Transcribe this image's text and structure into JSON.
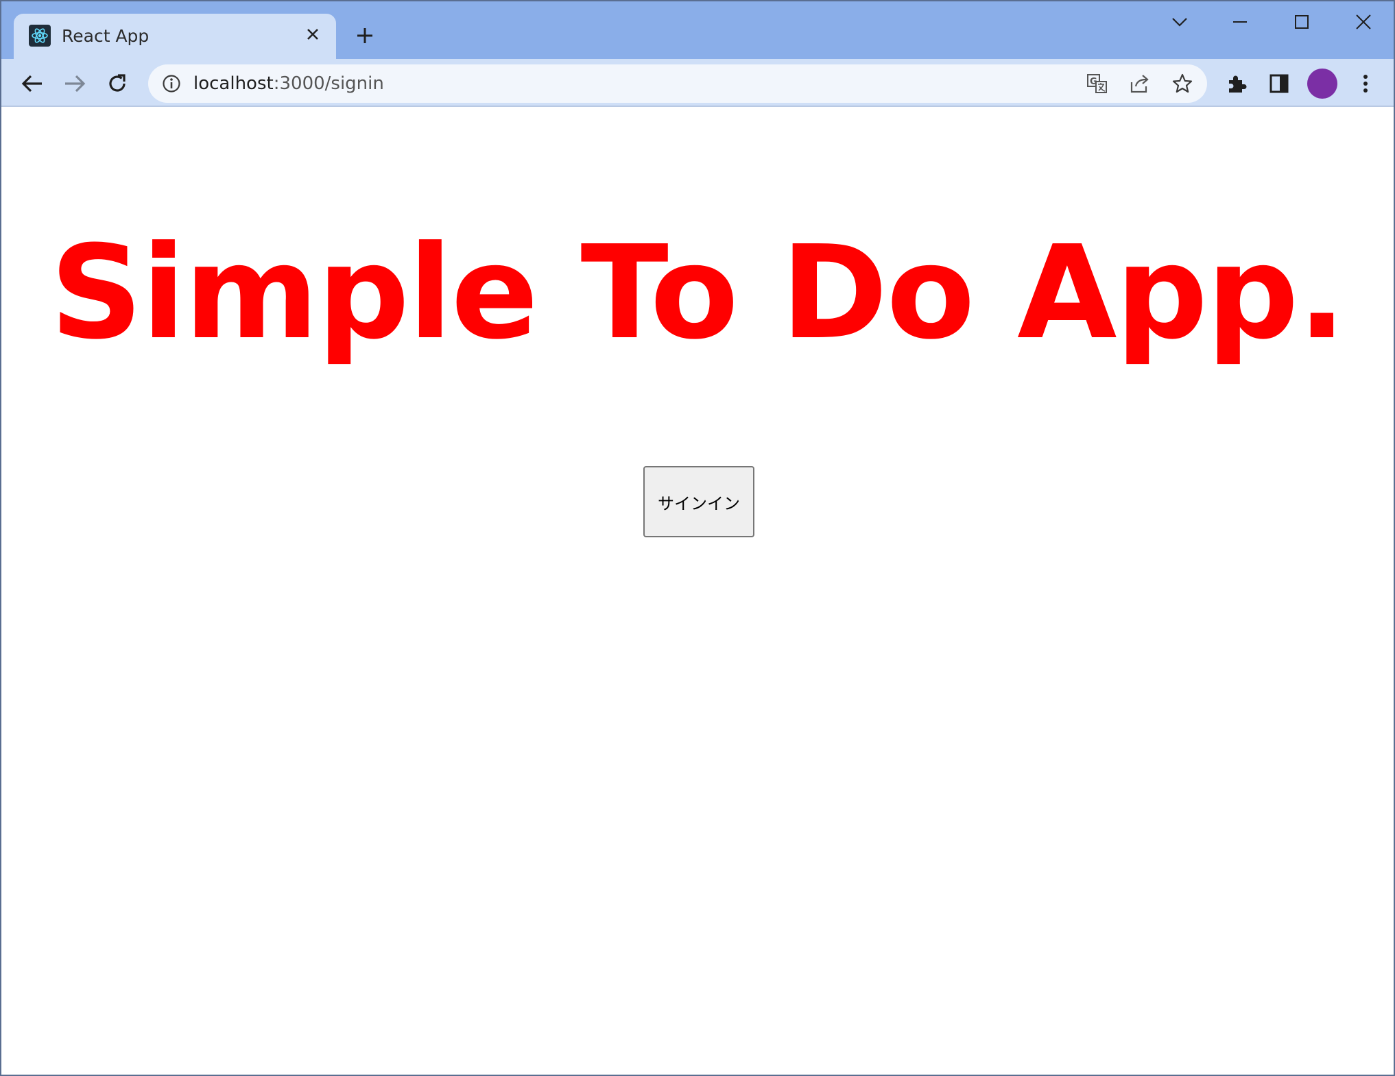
{
  "browser": {
    "tab": {
      "title": "React App",
      "favicon": "react-logo-icon"
    },
    "url": {
      "host": "localhost",
      "rest": ":3000/signin"
    },
    "toolbar_icons": [
      "back-arrow-icon",
      "forward-arrow-icon",
      "reload-icon",
      "info-icon",
      "translate-icon",
      "share-icon",
      "star-icon",
      "extensions-icon",
      "side-panel-icon",
      "profile-avatar",
      "kebab-menu-icon"
    ],
    "window_controls": [
      "tab-search-chevron-icon",
      "minimize-icon",
      "maximize-icon",
      "close-window-icon"
    ],
    "avatar_color": "#7b2fa5"
  },
  "page": {
    "heading": "Simple To Do App.",
    "heading_color": "#ff0000",
    "signin_button_label": "サインイン"
  }
}
